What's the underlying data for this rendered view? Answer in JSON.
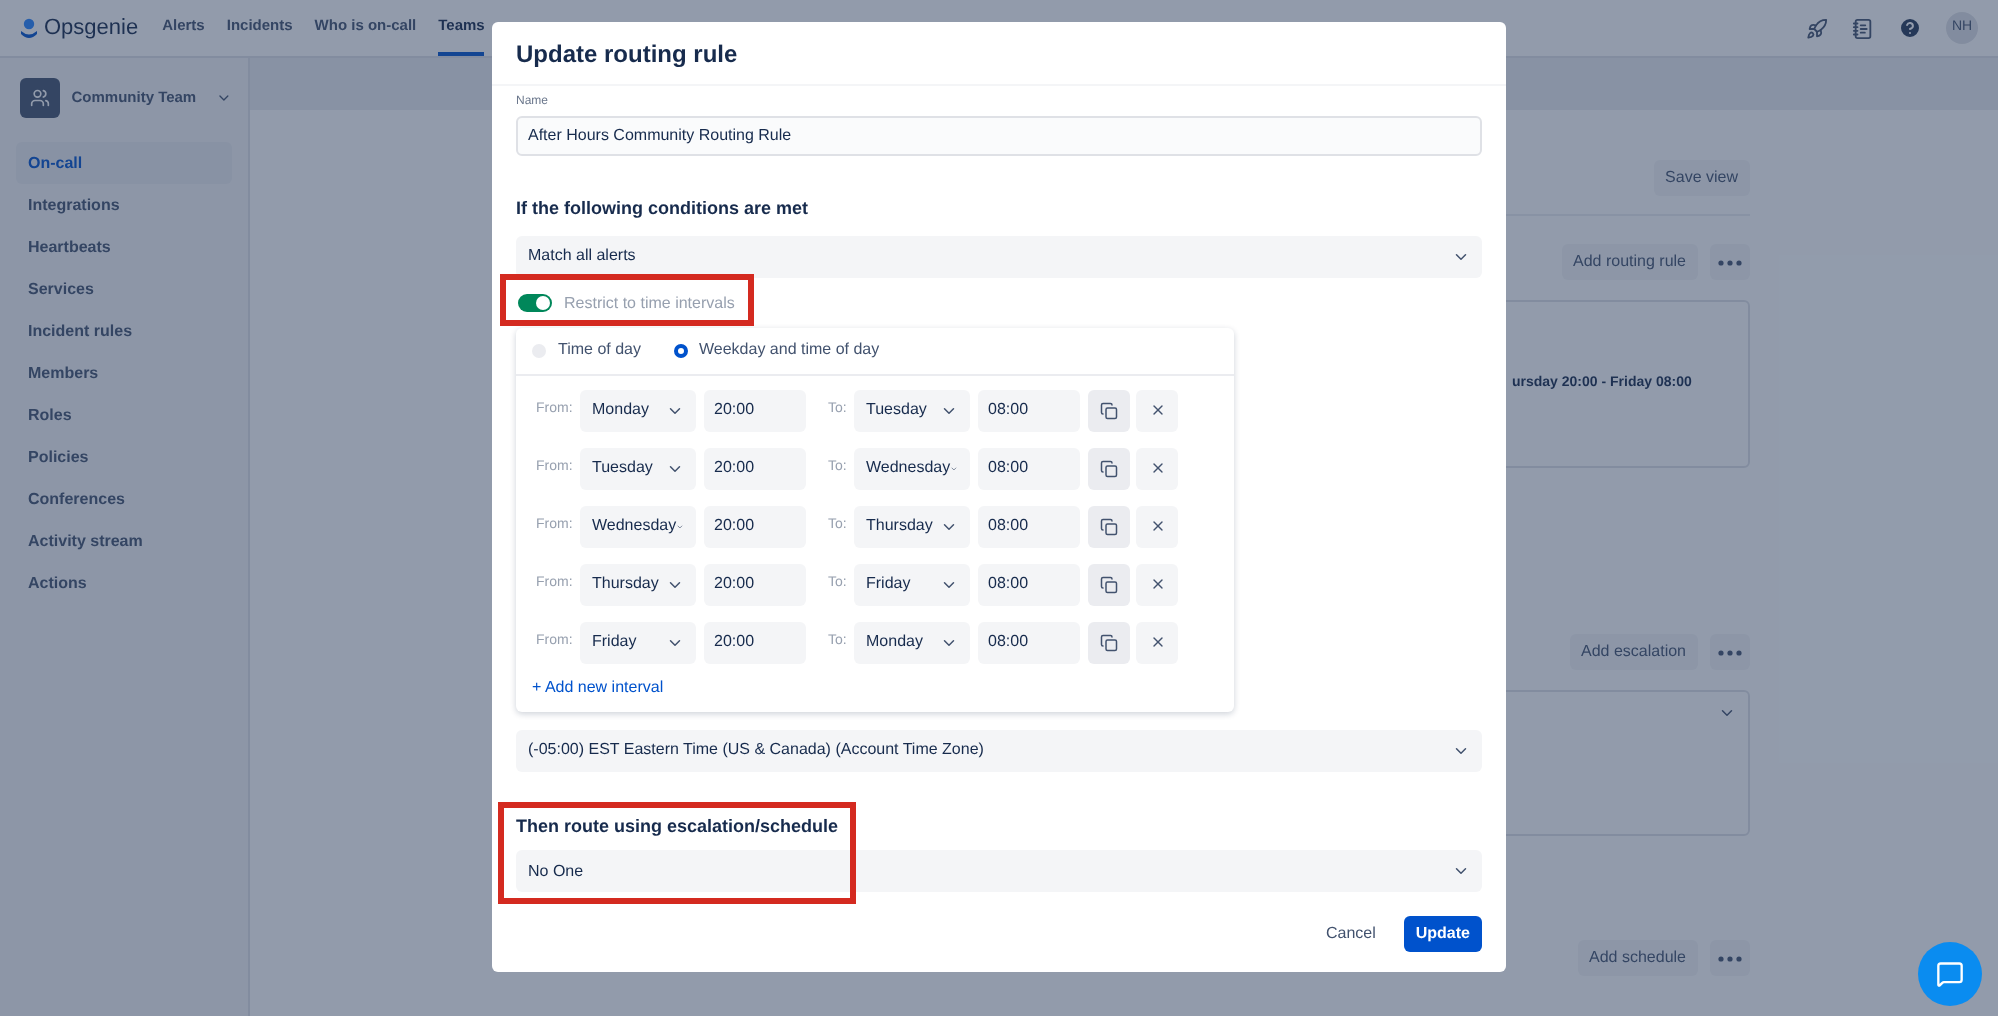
{
  "nav": {
    "logo": "Opsgenie",
    "avatar": "NH",
    "items": [
      {
        "label": "Alerts",
        "selected": false
      },
      {
        "label": "Incidents",
        "selected": false
      },
      {
        "label": "Who is on-call",
        "selected": false
      },
      {
        "label": "Teams",
        "selected": true
      }
    ]
  },
  "sidebar": {
    "team": "Community Team",
    "items": [
      {
        "label": "On-call",
        "selected": true
      },
      {
        "label": "Integrations",
        "selected": false
      },
      {
        "label": "Heartbeats",
        "selected": false
      },
      {
        "label": "Services",
        "selected": false
      },
      {
        "label": "Incident rules",
        "selected": false
      },
      {
        "label": "Members",
        "selected": false
      },
      {
        "label": "Roles",
        "selected": false
      },
      {
        "label": "Policies",
        "selected": false
      },
      {
        "label": "Conferences",
        "selected": false
      },
      {
        "label": "Activity stream",
        "selected": false
      },
      {
        "label": "Actions",
        "selected": false
      }
    ]
  },
  "page": {
    "save_view": "Save view",
    "routing_button": "Add routing rule",
    "routing_card_text": "ursday 20:00 - Friday 08:00",
    "escalation_button": "Add escalation",
    "schedule_button": "Add schedule"
  },
  "dialog": {
    "title": "Update routing rule",
    "name_label": "Name",
    "name_value": "After Hours Community Routing Rule",
    "conditions_heading": "If the following conditions are met",
    "condition_value": "Match all alerts",
    "restrict": {
      "label": "Restrict to time intervals",
      "on": true
    },
    "interval_types": [
      {
        "label": "Time of day",
        "selected": false
      },
      {
        "label": "Weekday and time of day",
        "selected": true
      }
    ],
    "intervals": [
      {
        "from_label": "From:",
        "from_day": "Monday",
        "from_time": "20:00",
        "to_label": "To:",
        "to_day": "Tuesday",
        "to_time": "08:00"
      },
      {
        "from_label": "From:",
        "from_day": "Tuesday",
        "from_time": "20:00",
        "to_label": "To:",
        "to_day": "Wednesday",
        "to_time": "08:00"
      },
      {
        "from_label": "From:",
        "from_day": "Wednesday",
        "from_time": "20:00",
        "to_label": "To:",
        "to_day": "Thursday",
        "to_time": "08:00"
      },
      {
        "from_label": "From:",
        "from_day": "Thursday",
        "from_time": "20:00",
        "to_label": "To:",
        "to_day": "Friday",
        "to_time": "08:00"
      },
      {
        "from_label": "From:",
        "from_day": "Friday",
        "from_time": "20:00",
        "to_label": "To:",
        "to_day": "Monday",
        "to_time": "08:00"
      }
    ],
    "add_interval": "+ Add new interval",
    "timezone": "(-05:00) EST Eastern Time (US & Canada) (Account Time Zone)",
    "route_heading": "Then route using escalation/schedule",
    "route_value": "No One",
    "cancel": "Cancel",
    "update": "Update"
  }
}
